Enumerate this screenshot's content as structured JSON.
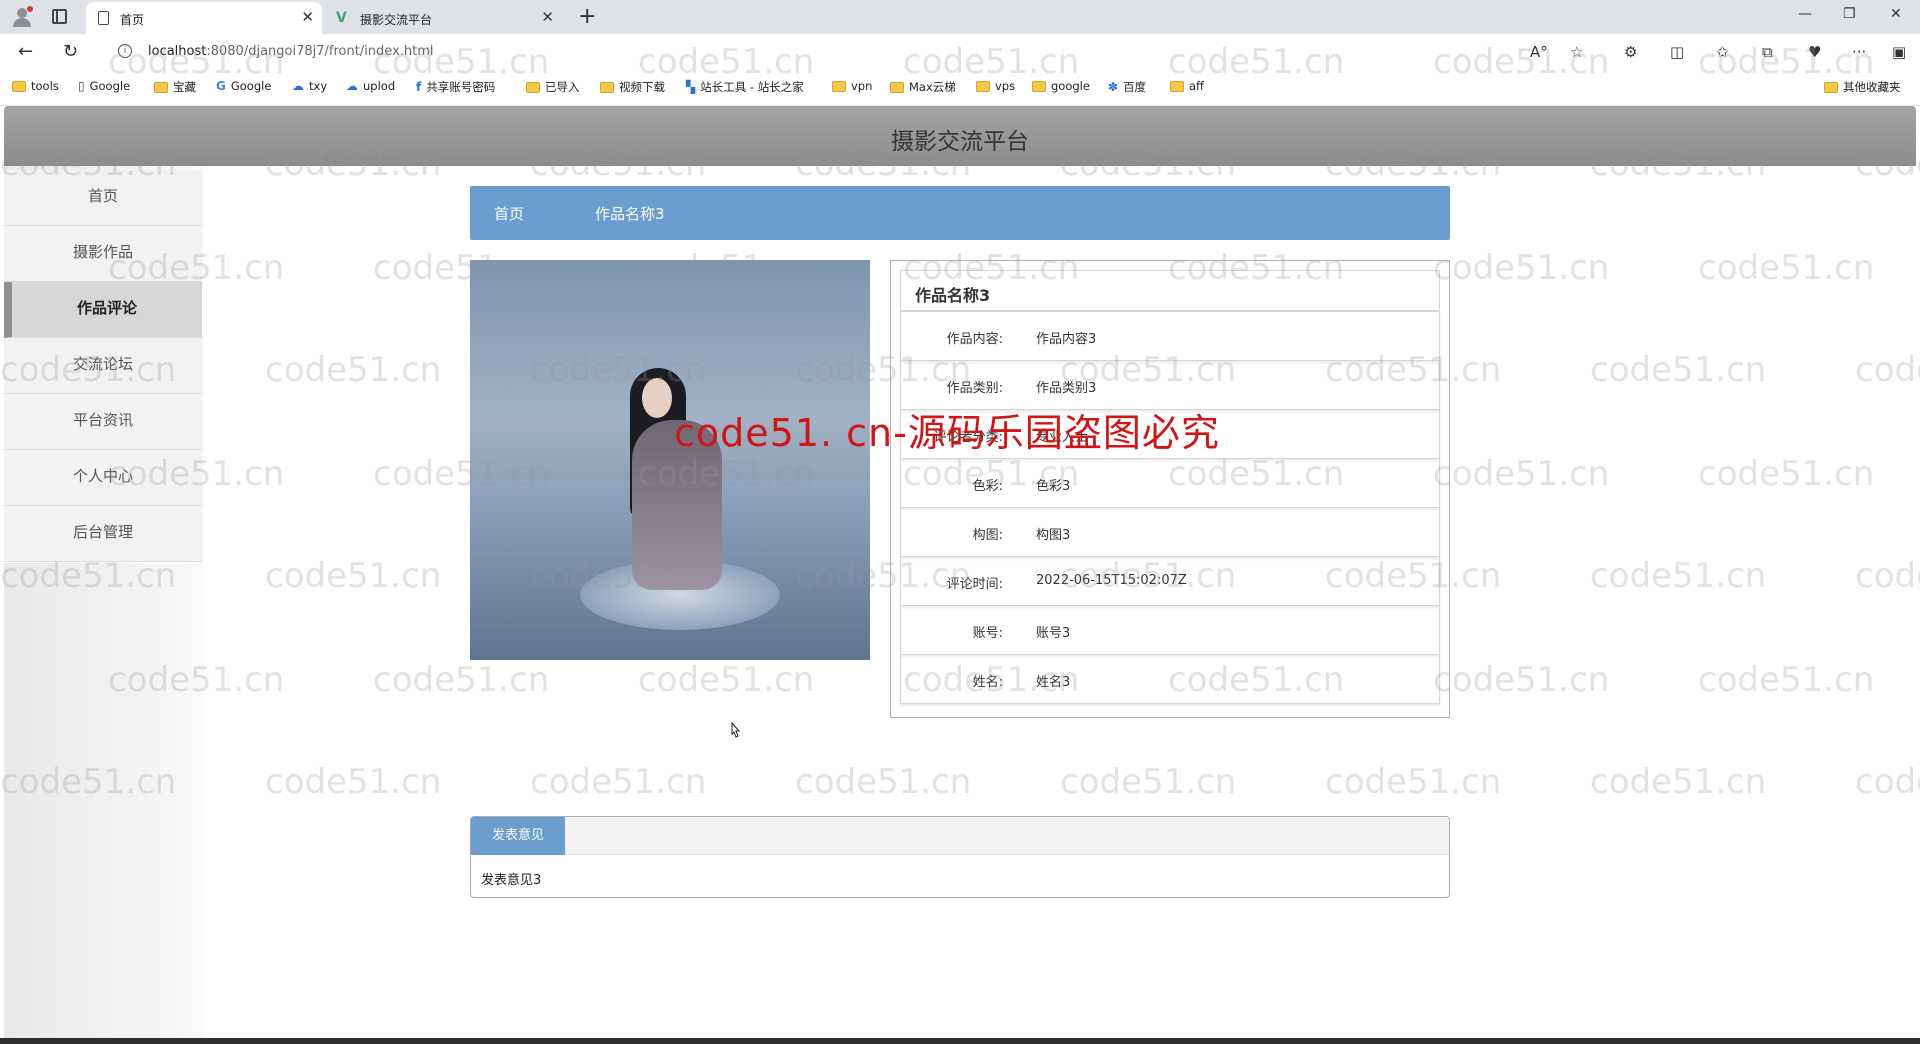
{
  "browser": {
    "tabs": [
      {
        "label": "首页"
      },
      {
        "label": "摄影交流平台"
      }
    ],
    "url_host": "localhost",
    "url_rest": ":8080/djangoi78j7/front/index.html",
    "bookmarks": [
      "tools",
      "Google",
      "宝藏",
      "Google",
      "txy",
      "uplod",
      "共享账号密码",
      "已导入",
      "视频下载",
      "站长工具 - 站长之家",
      "vpn",
      "Max云梯",
      "vps",
      "google",
      "百度",
      "aff"
    ],
    "other_bookmarks": "其他收藏夹"
  },
  "site": {
    "title": "摄影交流平台"
  },
  "sidebar": {
    "items": [
      {
        "label": "首页"
      },
      {
        "label": "摄影作品"
      },
      {
        "label": "作品评论"
      },
      {
        "label": "交流论坛"
      },
      {
        "label": "平台资讯"
      },
      {
        "label": "个人中心"
      },
      {
        "label": "后台管理"
      }
    ]
  },
  "breadcrumb": {
    "home": "首页",
    "current": "作品名称3"
  },
  "detail": {
    "title": "作品名称3",
    "rows": [
      {
        "label": "作品内容:",
        "value": "作品内容3"
      },
      {
        "label": "作品类别:",
        "value": "作品类别3"
      },
      {
        "label": "评论者分类:",
        "value": "专业人士"
      },
      {
        "label": "色彩:",
        "value": "色彩3"
      },
      {
        "label": "构图:",
        "value": "构图3"
      },
      {
        "label": "评论时间:",
        "value": "2022-06-15T15:02:07Z"
      },
      {
        "label": "账号:",
        "value": "账号3"
      },
      {
        "label": "姓名:",
        "value": "姓名3"
      }
    ]
  },
  "comment": {
    "tab_label": "发表意见",
    "content": "发表意见3"
  },
  "overlay": {
    "watermark_text": "code51. cn-源码乐园盗图必究",
    "repeat_text": "code51.cn"
  },
  "colors": {
    "accent": "#6b9ece",
    "header": "#999999",
    "watermark": "#d21414"
  }
}
